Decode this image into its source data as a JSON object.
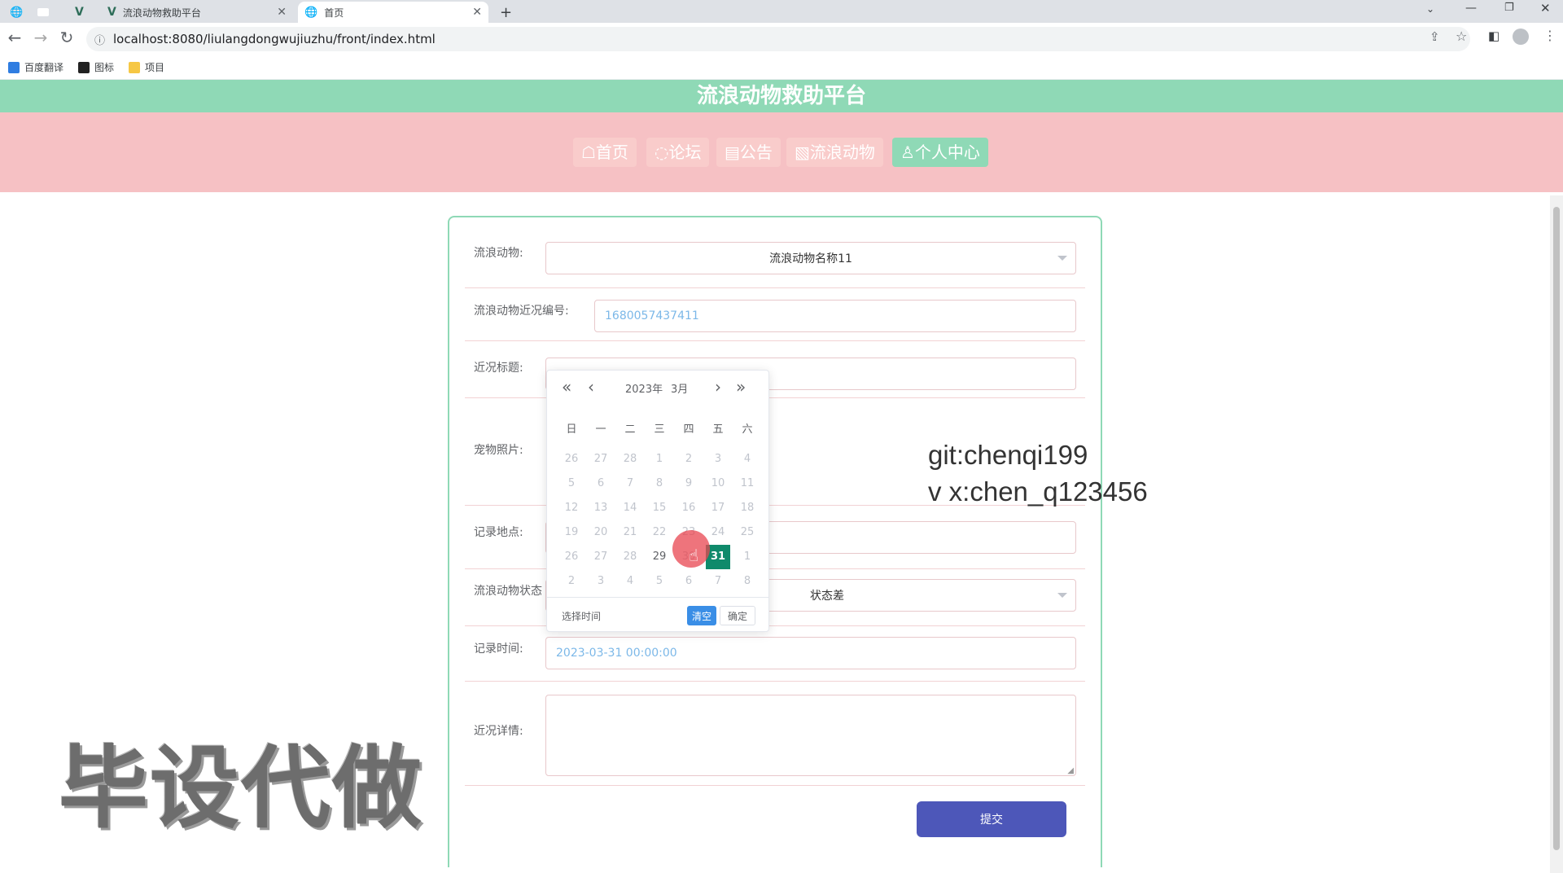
{
  "browser": {
    "tabs": [
      {
        "label": ""
      },
      {
        "label": ""
      },
      {
        "label": ""
      },
      {
        "label": "流浪动物救助平台"
      },
      {
        "label": "首页"
      }
    ],
    "new_tab": "+",
    "url": "localhost:8080/liulangdongwujiuzhu/front/index.html",
    "bookmarks": [
      {
        "label": "百度翻译",
        "color": "#2f7de1"
      },
      {
        "label": "图标",
        "color": "#222222"
      },
      {
        "label": "项目",
        "color": "#f6c744"
      }
    ]
  },
  "site": {
    "title": "流浪动物救助平台",
    "menu": [
      {
        "label": "☖首页"
      },
      {
        "label": "◌论坛"
      },
      {
        "label": "▤公告"
      },
      {
        "label": "▧流浪动物"
      },
      {
        "label": "♙个人中心"
      }
    ]
  },
  "form": {
    "animal_label": "流浪动物:",
    "animal_value": "流浪动物名称11",
    "code_label": "流浪动物近况编号:",
    "code_value": "1680057437411",
    "title_label": "近况标题:",
    "photo_label": "宠物照片:",
    "place_label": "记录地点:",
    "status_label": "流浪动物状态",
    "status_value": "状态差",
    "time_label": "记录时间:",
    "time_value": "2023-03-31 00:00:00",
    "detail_label": "近况详情:",
    "submit": "提交"
  },
  "datepicker": {
    "year": "2023年",
    "month": "3月",
    "prev_year": "«",
    "prev_month": "‹",
    "next_month": "›",
    "next_year": "»",
    "weekdays": [
      "日",
      "一",
      "二",
      "三",
      "四",
      "五",
      "六"
    ],
    "days": [
      [
        "26",
        "27",
        "28",
        "1",
        "2",
        "3",
        "4"
      ],
      [
        "5",
        "6",
        "7",
        "8",
        "9",
        "10",
        "11"
      ],
      [
        "12",
        "13",
        "14",
        "15",
        "16",
        "17",
        "18"
      ],
      [
        "19",
        "20",
        "21",
        "22",
        "23",
        "24",
        "25"
      ],
      [
        "26",
        "27",
        "28",
        "29",
        "30",
        "31",
        "1"
      ],
      [
        "2",
        "3",
        "4",
        "5",
        "6",
        "7",
        "8"
      ]
    ],
    "selected": "31",
    "select_time": "选择时间",
    "clear": "清空",
    "confirm": "确定"
  },
  "watermarks": {
    "git": "git:chenqi199",
    "wx": "v x:chen_q123456",
    "big": "毕设代做"
  }
}
